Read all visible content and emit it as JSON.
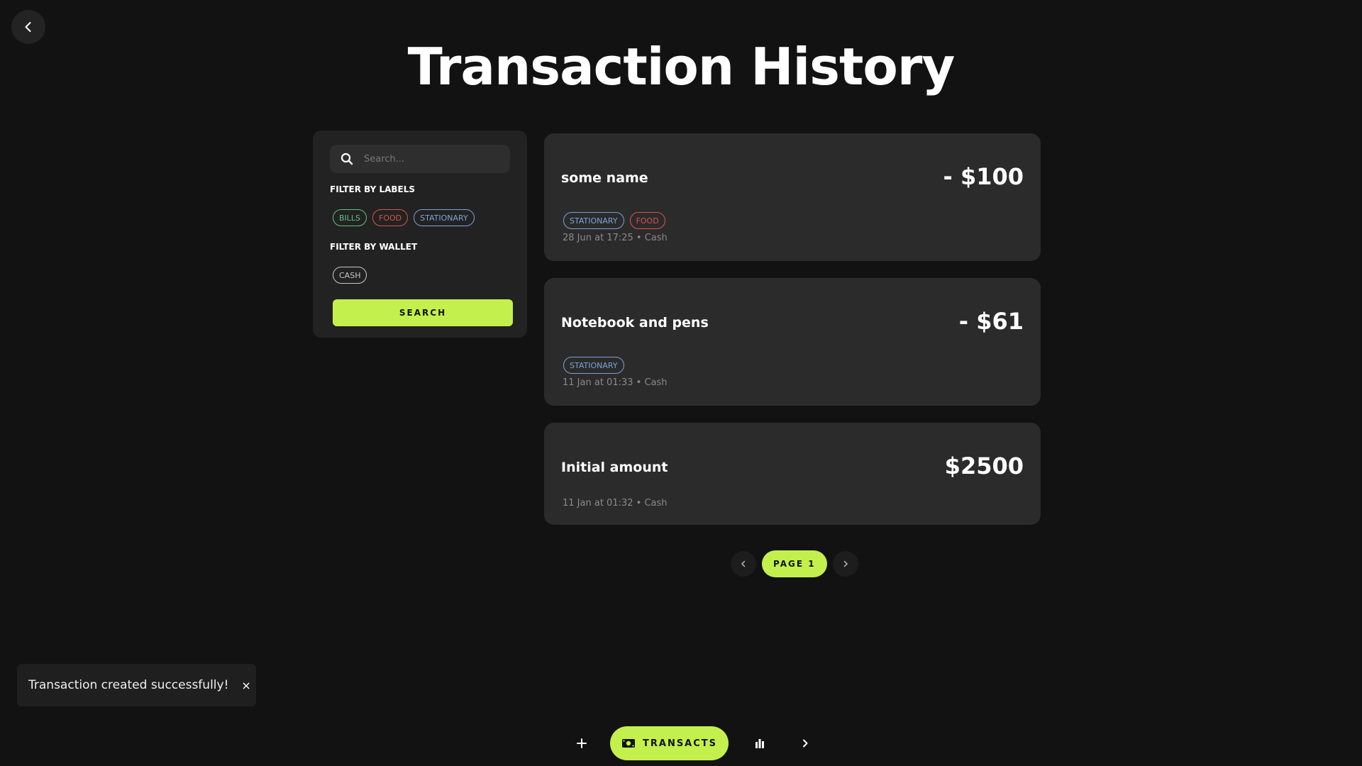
{
  "page": {
    "title": "Transaction History"
  },
  "filters": {
    "search_placeholder": "Search...",
    "labels_heading": "FILTER BY LABELS",
    "labels": [
      {
        "text": "BILLS",
        "color": "#5fbf87"
      },
      {
        "text": "FOOD",
        "color": "#d9514f"
      },
      {
        "text": "STATIONARY",
        "color": "#7da2d6"
      }
    ],
    "wallet_heading": "FILTER BY WALLET",
    "wallets": [
      {
        "text": "CASH",
        "color": "#c8c8c8"
      }
    ],
    "search_button": "SEARCH"
  },
  "transactions": [
    {
      "name": "some name",
      "amount": "- $100",
      "tags": [
        "STATIONARY",
        "FOOD"
      ],
      "meta": "28 Jun at 17:25 • Cash"
    },
    {
      "name": "Notebook and pens",
      "amount": "- $61",
      "tags": [
        "STATIONARY"
      ],
      "meta": "11 Jan at 01:33 • Cash"
    },
    {
      "name": "Initial amount",
      "amount": "$2500",
      "tags": [],
      "meta": "11 Jan at 01:32 • Cash"
    }
  ],
  "pagination": {
    "current": "PAGE 1"
  },
  "toast": {
    "message": "Transaction created successfully!",
    "close": "×"
  },
  "bottom_nav": {
    "active_label": "TRANSACTS"
  },
  "colors": {
    "accent": "#c3f04d",
    "background": "#121212",
    "card": "#2b2b2b"
  }
}
